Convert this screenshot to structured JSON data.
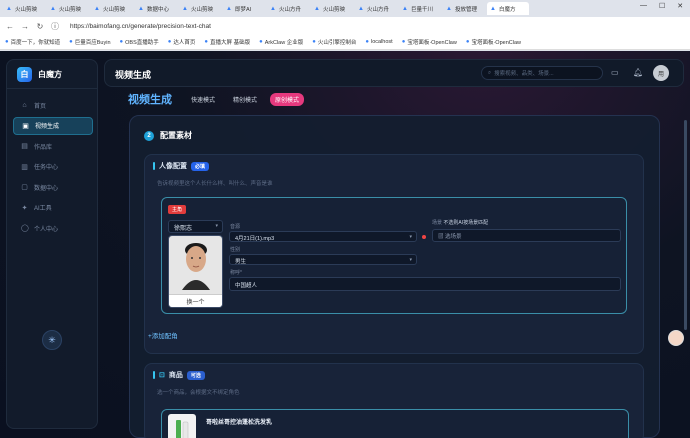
{
  "browser": {
    "tabs": [
      {
        "label": "火山剪映"
      },
      {
        "label": "火山剪映"
      },
      {
        "label": "火山剪映"
      },
      {
        "label": "数据中心"
      },
      {
        "label": "火山剪映"
      },
      {
        "label": "即梦AI"
      },
      {
        "label": "火山方舟"
      },
      {
        "label": "火山剪映"
      },
      {
        "label": "火山方舟"
      },
      {
        "label": "巨量千川"
      },
      {
        "label": "投放管理"
      },
      {
        "label": "白魔方"
      }
    ],
    "url": "https://baimofang.cn/generate/precision-text-chat",
    "bookmarks": [
      "百度一下，你就知道",
      "巨量百应Buyin",
      "OBS直播助手",
      "达人首页",
      "直播大屏 基础版",
      "ArkClaw 企业版",
      "火山引擎控制台",
      "localhost",
      "宝塔面板·OpenClaw",
      "宝塔面板·OpenClaw"
    ]
  },
  "app": {
    "logo_text": "白魔方",
    "logo_char": "白",
    "nav": [
      {
        "label": "首页",
        "icon": "home-icon",
        "glyph": "⌂"
      },
      {
        "label": "视频生成",
        "icon": "video-icon",
        "glyph": "▣"
      },
      {
        "label": "作品库",
        "icon": "library-icon",
        "glyph": "▤"
      },
      {
        "label": "任务中心",
        "icon": "task-icon",
        "glyph": "▥"
      },
      {
        "label": "数据中心",
        "icon": "data-icon",
        "glyph": "▢"
      },
      {
        "label": "AI工具",
        "icon": "ai-tool-icon",
        "glyph": "✦"
      },
      {
        "label": "个人中心",
        "icon": "user-icon",
        "glyph": "◯"
      }
    ],
    "page_title": "视频生成",
    "search_placeholder": "搜索视频、品类、场景...",
    "avatar_text": "用"
  },
  "main": {
    "heading": "视频生成",
    "modes": [
      "快速模式",
      "精创模式",
      "原创模式"
    ],
    "step_number": "2",
    "step_title": "配置素材",
    "character_section": {
      "title": "人像配置",
      "badge": "必填",
      "desc": "告诉视频里这个人长什么样、叫什么、声音是谁",
      "lead_tag": "主角",
      "selected_character": "徐熙志",
      "swap_label": "换一个",
      "voice_label": "音源",
      "voice_value": "4月21日(1).mp3",
      "gender_label": "性别",
      "gender_value": "男生",
      "identity_label": "称呼*",
      "identity_value": "中国超人",
      "scene_label": "场景",
      "scene_hint": "不选则AI按场景匹配",
      "scene_placeholder": "选场景",
      "add_link": "+添加配角"
    },
    "product_section": {
      "title": "商品",
      "badge": "可选",
      "desc": "选一个商品，会根据文不绑定角色",
      "product_name": "哥啦丝哥控油蓬松洗发乳"
    }
  }
}
